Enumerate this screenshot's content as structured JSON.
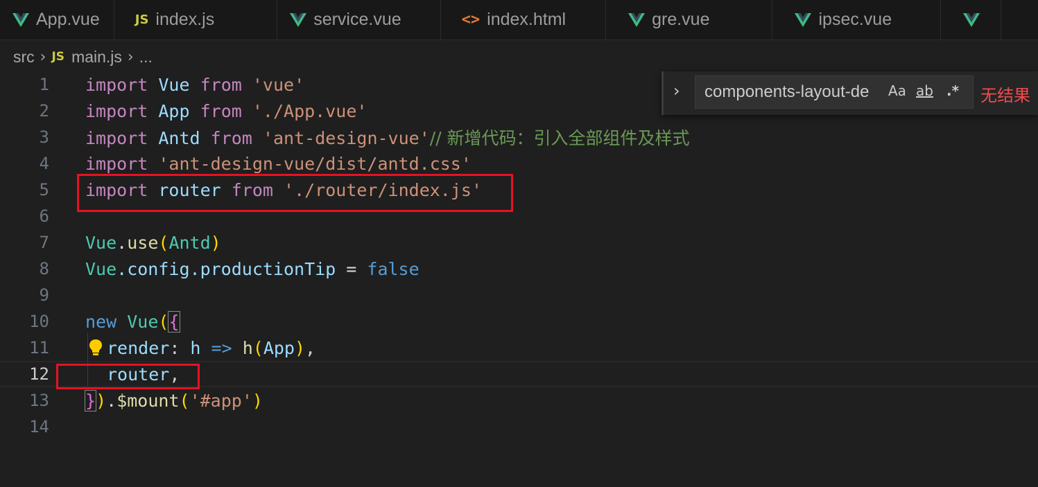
{
  "tabs": [
    {
      "label": "App.vue",
      "icon": "vue-icon"
    },
    {
      "label": "index.js",
      "icon": "js-icon"
    },
    {
      "label": "service.vue",
      "icon": "vue-icon"
    },
    {
      "label": "index.html",
      "icon": "html-icon"
    },
    {
      "label": "gre.vue",
      "icon": "vue-icon"
    },
    {
      "label": "ipsec.vue",
      "icon": "vue-icon"
    }
  ],
  "icons": {
    "js_glyph": "JS",
    "html_glyph": "<>"
  },
  "breadcrumb": {
    "folder": "src",
    "file": "main.js",
    "more": "..."
  },
  "find": {
    "value": "components-layout-de",
    "match_case": "Aa",
    "whole_word": "ab",
    "regex": ".*",
    "result": "无结果"
  },
  "code": {
    "line_numbers": [
      "1",
      "2",
      "3",
      "4",
      "5",
      "6",
      "7",
      "8",
      "9",
      "10",
      "11",
      "12",
      "13",
      "14"
    ],
    "l1": {
      "kw": "import",
      "id": "Vue",
      "from": "from",
      "str": "'vue'"
    },
    "l2": {
      "kw": "import",
      "id": "App",
      "from": "from",
      "str": "'./App.vue'"
    },
    "l3": {
      "kw": "import",
      "id": "Antd",
      "from": "from",
      "str": "'ant-design-vue'",
      "comment": "// 新增代码：引入全部组件及样式"
    },
    "l4": {
      "kw": "import",
      "str": "'ant-design-vue/dist/antd.css'"
    },
    "l5": {
      "kw": "import",
      "id": "router",
      "from": "from",
      "str": "'./router/index.js'"
    },
    "l7": {
      "obj": "Vue",
      "dot": ".",
      "fn": "use",
      "open": "(",
      "arg": "Antd",
      "close": ")"
    },
    "l8": {
      "obj": "Vue",
      "p1": ".config.productionTip",
      "eq": " = ",
      "val": "false"
    },
    "l10": {
      "kw": "new",
      "cls": "Vue",
      "open": "(",
      "brace": "{"
    },
    "l11": {
      "key": "render",
      "colon": ": ",
      "param": "h",
      "arrow": " => ",
      "fn": "h",
      "open": "(",
      "arg": "App",
      "close": ")",
      "comma": ","
    },
    "l12": {
      "id": "router",
      "comma": ","
    },
    "l13": {
      "brace": "}",
      "close": ")",
      "dot": ".",
      "fn": "$mount",
      "open": "(",
      "str": "'#app'",
      "close2": ")"
    }
  },
  "colors": {
    "highlight_box": "#e81123",
    "no_result": "#f14c4c"
  }
}
